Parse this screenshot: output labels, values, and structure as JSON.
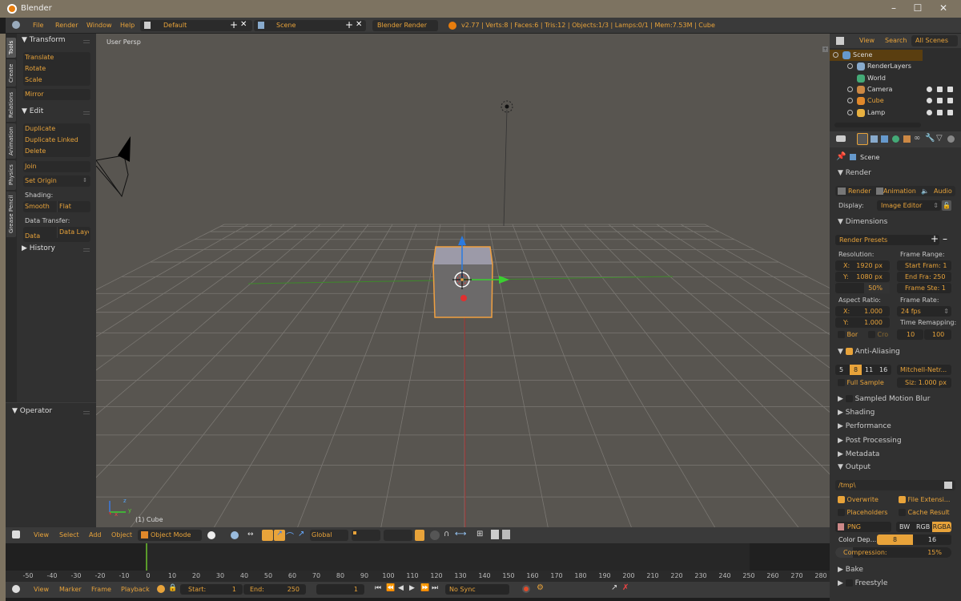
{
  "window": {
    "title": "Blender",
    "controls": [
      "minimize",
      "maximize",
      "close"
    ]
  },
  "topbar": {
    "menus": [
      "File",
      "Render",
      "Window",
      "Help"
    ],
    "screen_layout": "Default",
    "scene": "Scene",
    "render_engine": "Blender Render",
    "stats": "v2.77 | Verts:8 | Faces:6 | Tris:12 | Objects:1/3 | Lamps:0/1 | Mem:7.53M | Cube"
  },
  "toolshelf": {
    "tabs": [
      "Tools",
      "Create",
      "Relations",
      "Animation",
      "Physics",
      "Grease Pencil"
    ],
    "active_tab": "Tools",
    "transform": {
      "title": "Transform",
      "buttons": [
        "Translate",
        "Rotate",
        "Scale"
      ],
      "mirror": "Mirror"
    },
    "edit": {
      "title": "Edit",
      "buttons": [
        "Duplicate",
        "Duplicate Linked",
        "Delete"
      ],
      "join": "Join",
      "set_origin": "Set Origin",
      "shading_label": "Shading:",
      "smooth": "Smooth",
      "flat": "Flat",
      "data_transfer_label": "Data Transfer:",
      "data": "Data",
      "data_layout": "Data Layo"
    },
    "history": "History",
    "operator": "Operator"
  },
  "viewport": {
    "view_name": "User Persp",
    "active_object": "(1) Cube",
    "axis_labels": {
      "x": "x",
      "y": "y",
      "z": "z"
    }
  },
  "view3d_header": {
    "menus": [
      "View",
      "Select",
      "Add",
      "Object"
    ],
    "mode": "Object Mode",
    "orientation": "Global"
  },
  "outliner": {
    "menus": [
      "View",
      "Search",
      "All Scenes"
    ],
    "items": [
      {
        "name": "Scene",
        "depth": 0,
        "selected": true
      },
      {
        "name": "RenderLayers",
        "depth": 1
      },
      {
        "name": "World",
        "depth": 1
      },
      {
        "name": "Camera",
        "depth": 1
      },
      {
        "name": "Cube",
        "depth": 1,
        "active": true
      },
      {
        "name": "Lamp",
        "depth": 1
      }
    ]
  },
  "properties": {
    "context": "Scene",
    "render": {
      "title": "Render",
      "buttons": [
        "Render",
        "Animation",
        "Audio"
      ],
      "display_label": "Display:",
      "display_value": "Image Editor"
    },
    "dimensions": {
      "title": "Dimensions",
      "presets": "Render Presets",
      "resolution_label": "Resolution:",
      "res_x": "X:",
      "res_x_val": "1920 px",
      "res_y": "Y:",
      "res_y_val": "1080 px",
      "res_pct": "50%",
      "frame_range_label": "Frame Range:",
      "start": "Start Fram: 1",
      "end": "End Fra: 250",
      "step": "Frame Ste: 1",
      "aspect_label": "Aspect Ratio:",
      "asp_x": "X:",
      "asp_x_val": "1.000",
      "asp_y": "Y:",
      "asp_y_val": "1.000",
      "frame_rate_label": "Frame Rate:",
      "fps": "24 fps",
      "time_remap_label": "Time Remapping:",
      "remap_old": "10",
      "remap_new": "100",
      "border": "Bor",
      "crop": "Cro"
    },
    "anti_aliasing": {
      "title": "Anti-Aliasing",
      "enabled": true,
      "samples": [
        "5",
        "8",
        "11",
        "16"
      ],
      "active_sample": "8",
      "filter": "Mitchell-Netr...",
      "full_sample": "Full Sample",
      "size": "Siz: 1.000 px"
    },
    "collapsed_sections": [
      "Sampled Motion Blur",
      "Shading",
      "Performance",
      "Post Processing",
      "Metadata"
    ],
    "output": {
      "title": "Output",
      "path": "/tmp\\",
      "overwrite": "Overwrite",
      "file_ext": "File Extensi...",
      "placeholders": "Placeholders",
      "cache_result": "Cache Result",
      "format": "PNG",
      "color_modes": [
        "BW",
        "RGB",
        "RGBA"
      ],
      "active_color_mode": "RGBA",
      "color_depth_label": "Color Dep...",
      "depth_options": [
        "8",
        "16"
      ],
      "active_depth": "8",
      "compression_label": "Compression:",
      "compression": "15%"
    },
    "bottom_sections": [
      "Bake",
      "Freestyle"
    ]
  },
  "timeline": {
    "ruler": [
      "-50",
      "-40",
      "-30",
      "-20",
      "-10",
      "0",
      "10",
      "20",
      "30",
      "40",
      "50",
      "60",
      "70",
      "80",
      "90",
      "100",
      "110",
      "120",
      "130",
      "140",
      "150",
      "160",
      "170",
      "180",
      "190",
      "200",
      "210",
      "220",
      "230",
      "240",
      "250",
      "260",
      "270",
      "280"
    ],
    "menus": [
      "View",
      "Marker",
      "Frame",
      "Playback"
    ],
    "start_label": "Start:",
    "start": "1",
    "end_label": "End:",
    "end": "250",
    "current_frame": "1",
    "sync": "No Sync"
  }
}
